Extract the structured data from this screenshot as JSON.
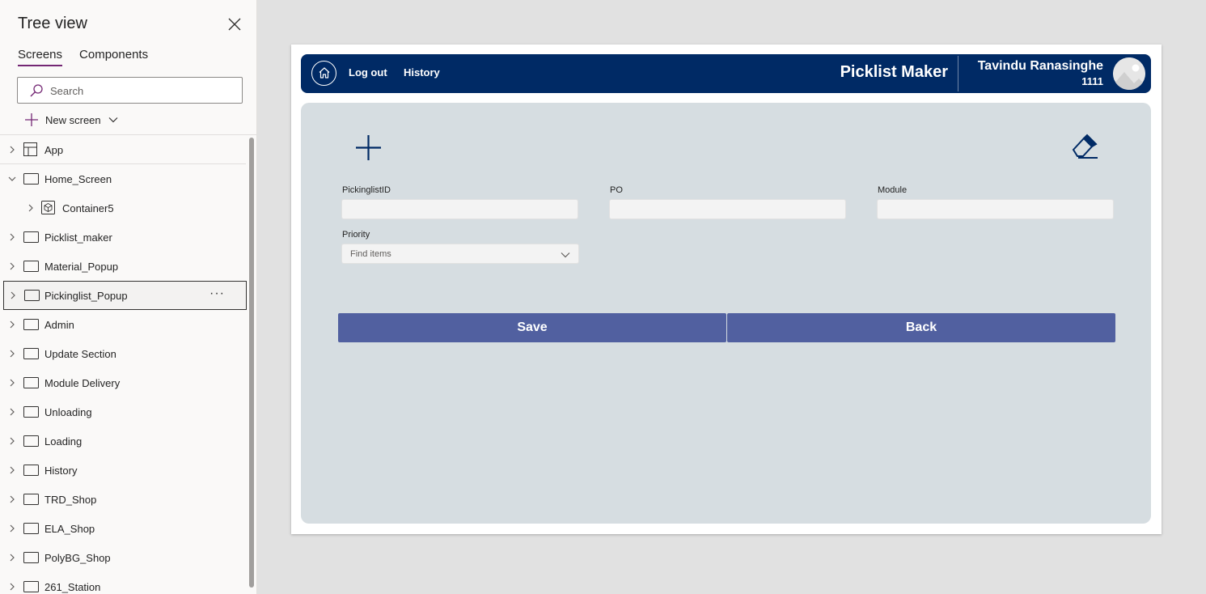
{
  "tree_view": {
    "title": "Tree view",
    "tabs": [
      {
        "label": "Screens",
        "active": true
      },
      {
        "label": "Components",
        "active": false
      }
    ],
    "search": {
      "placeholder": "Search",
      "value": ""
    },
    "new_screen_label": "New screen",
    "items": [
      {
        "label": "App",
        "icon": "app-icon"
      },
      {
        "label": "Home_Screen",
        "icon": "screen-icon",
        "expanded": true
      },
      {
        "label": "Container5",
        "icon": "container-icon",
        "nested": true
      },
      {
        "label": "Picklist_maker",
        "icon": "screen-icon"
      },
      {
        "label": "Material_Popup",
        "icon": "screen-icon"
      },
      {
        "label": "Pickinglist_Popup",
        "icon": "screen-icon",
        "selected": true
      },
      {
        "label": "Admin",
        "icon": "screen-icon"
      },
      {
        "label": "Update Section",
        "icon": "screen-icon"
      },
      {
        "label": "Module Delivery",
        "icon": "screen-icon"
      },
      {
        "label": "Unloading",
        "icon": "screen-icon"
      },
      {
        "label": "Loading",
        "icon": "screen-icon"
      },
      {
        "label": "History",
        "icon": "screen-icon"
      },
      {
        "label": "TRD_Shop",
        "icon": "screen-icon"
      },
      {
        "label": "ELA_Shop",
        "icon": "screen-icon"
      },
      {
        "label": "PolyBG_Shop",
        "icon": "screen-icon"
      },
      {
        "label": "261_Station",
        "icon": "screen-icon"
      }
    ]
  },
  "app": {
    "header": {
      "logout_label": "Log out",
      "history_label": "History",
      "title": "Picklist Maker",
      "user_name": "Tavindu Ranasinghe",
      "user_id": "1111"
    },
    "form": {
      "fields": [
        {
          "label": "PickinglistID",
          "value": ""
        },
        {
          "label": "PO",
          "value": ""
        },
        {
          "label": "Module",
          "value": ""
        }
      ],
      "priority": {
        "label": "Priority",
        "placeholder": "Find items"
      },
      "save_label": "Save",
      "back_label": "Back"
    }
  },
  "colors": {
    "header_bg": "#002a65",
    "panel_bg": "#d6dde1",
    "button_bg": "#5160a0",
    "tab_accent": "#742774"
  }
}
